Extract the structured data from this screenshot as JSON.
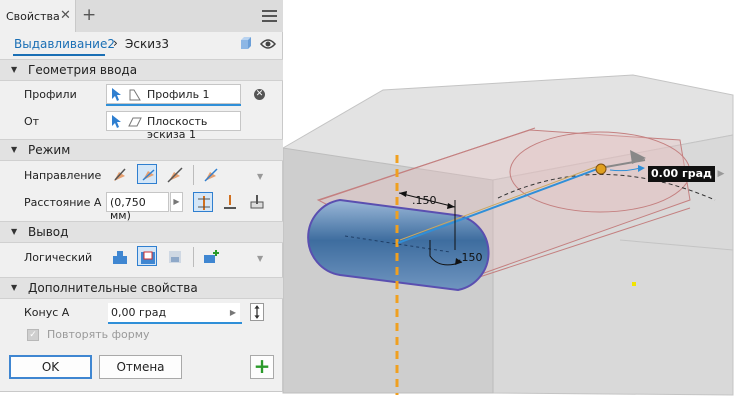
{
  "panel": {
    "tab_label": "Свойства",
    "tab_close": "✕",
    "tab_add": "+",
    "breadcrumb": {
      "feature": "Выдавливание2",
      "separator": "›",
      "sketch": "Эскиз3"
    },
    "sections": {
      "input_geometry": "Геометрия ввода",
      "mode": "Режим",
      "output": "Вывод",
      "advanced": "Дополнительные свойства"
    },
    "input_geometry": {
      "profiles_label": "Профили",
      "profiles_value": "Профиль 1",
      "from_label": "От",
      "from_value": "Плоскость эскиза 1"
    },
    "mode": {
      "direction_label": "Направление",
      "distance_label": "Расстояние A",
      "distance_value": "(0,750 мм)"
    },
    "output": {
      "boolean_label": "Логический"
    },
    "advanced": {
      "taper_label": "Конус A",
      "taper_value": "0,00 град",
      "repeat_shape_label": "Повторять форму",
      "repeat_shape_checked": true
    },
    "buttons": {
      "ok": "OK",
      "cancel": "Отмена",
      "add": "+"
    }
  },
  "viewport": {
    "dimension_1": ".150",
    "dimension_2": ".150",
    "angle_readout": "0.00 град",
    "accent_color": "#2f8fd8",
    "selection_color": "#f0a020"
  }
}
